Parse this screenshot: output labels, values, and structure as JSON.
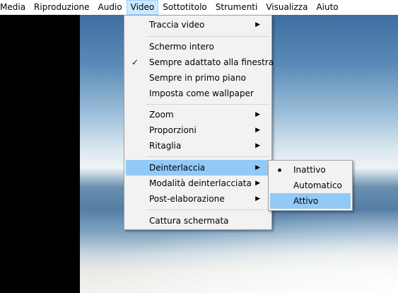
{
  "menubar": {
    "items": [
      "Media",
      "Riproduzione",
      "Audio",
      "Video",
      "Sottotitolo",
      "Strumenti",
      "Visualizza",
      "Aiuto"
    ],
    "active": "Video"
  },
  "video_menu": {
    "items": [
      {
        "label": "Traccia video",
        "submenu": true
      },
      {
        "label": "Schermo intero"
      },
      {
        "label": "Sempre adattato alla finestra",
        "checked": true
      },
      {
        "label": "Sempre in primo piano"
      },
      {
        "label": "Imposta come wallpaper"
      },
      {
        "label": "Zoom",
        "submenu": true
      },
      {
        "label": "Proporzioni",
        "submenu": true
      },
      {
        "label": "Ritaglia",
        "submenu": true
      },
      {
        "label": "Deinterlaccia",
        "submenu": true,
        "highlighted": true
      },
      {
        "label": "Modalità deinterlacciata",
        "submenu": true
      },
      {
        "label": "Post-elaborazione",
        "submenu": true
      },
      {
        "label": "Cattura schermata"
      }
    ]
  },
  "deinterlace_submenu": {
    "items": [
      {
        "label": "Inattivo",
        "selected": true
      },
      {
        "label": "Automatico"
      },
      {
        "label": "Attivo",
        "highlighted": true
      }
    ]
  },
  "glyphs": {
    "arrow": "▶",
    "check": "✓"
  }
}
